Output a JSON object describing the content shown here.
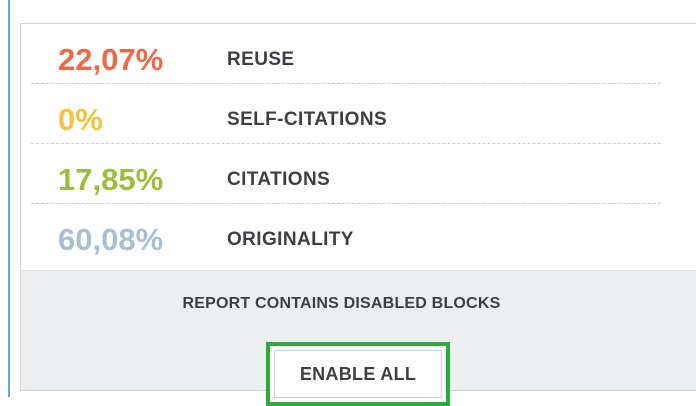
{
  "stats": [
    {
      "value": "22,07%",
      "label": "REUSE",
      "color": "#ec6a4a"
    },
    {
      "value": "0%",
      "label": "SELF-CITATIONS",
      "color": "#f6c340"
    },
    {
      "value": "17,85%",
      "label": "CITATIONS",
      "color": "#9cbd3e"
    },
    {
      "value": "60,08%",
      "label": "ORIGINALITY",
      "color": "#a7bfd3"
    }
  ],
  "footer": {
    "notice": "REPORT CONTAINS DISABLED BLOCKS",
    "enable_all_label": "ENABLE ALL",
    "highlight_color": "#2daa3d"
  }
}
